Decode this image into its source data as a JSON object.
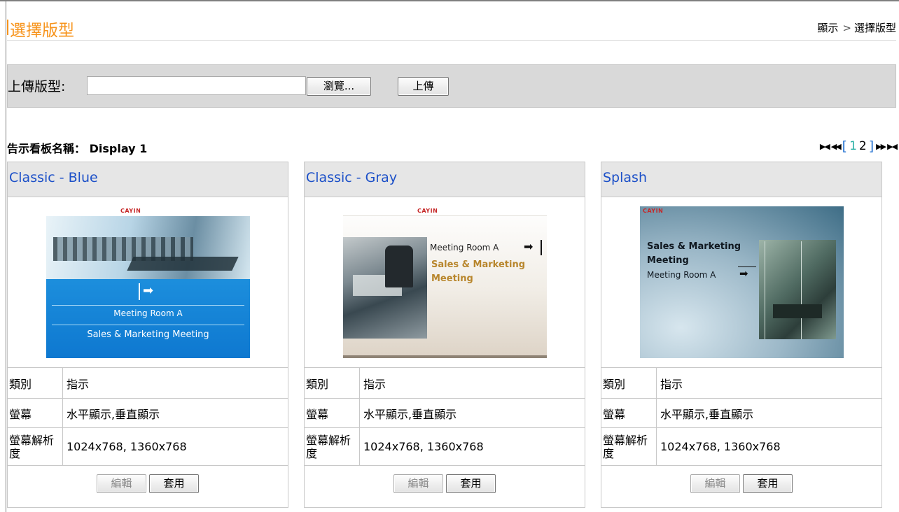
{
  "header": {
    "title": "選擇版型",
    "breadcrumb": {
      "parent": "顯示",
      "separator": ">",
      "current": "選擇版型"
    }
  },
  "upload": {
    "label": "上傳版型:",
    "file_value": "",
    "browse_label": "瀏覽...",
    "upload_label": "上傳"
  },
  "board": {
    "label": "告示看板名稱：",
    "name": "Display 1"
  },
  "pagination": {
    "first_icon": "first-page-icon",
    "prev_icon": "prev-page-icon",
    "open_bracket": "[",
    "pages": [
      "1",
      "2"
    ],
    "current_page": "1",
    "close_bracket": "]",
    "next_icon": "next-page-icon",
    "last_icon": "last-page-icon"
  },
  "labels": {
    "category": "類別",
    "screen": "螢幕",
    "resolution": "螢幕解析度",
    "edit": "編輯",
    "apply": "套用"
  },
  "templates": [
    {
      "name": "Classic - Blue",
      "category": "指示",
      "screen": "水平顯示,垂直顯示",
      "resolution": "1024x768, 1360x768",
      "thumb": {
        "logo": "CAYIN",
        "room": "Meeting Room A",
        "event": "Sales & Marketing Meeting"
      }
    },
    {
      "name": "Classic - Gray",
      "category": "指示",
      "screen": "水平顯示,垂直顯示",
      "resolution": "1024x768, 1360x768",
      "thumb": {
        "logo": "CAYIN",
        "room": "Meeting Room A",
        "event_line1": "Sales & Marketing",
        "event_line2": "Meeting"
      }
    },
    {
      "name": "Splash",
      "category": "指示",
      "screen": "水平顯示,垂直顯示",
      "resolution": "1024x768, 1360x768",
      "thumb": {
        "logo": "CAYIN",
        "event_line1": "Sales & Marketing",
        "event_line2": "Meeting",
        "room": "Meeting Room A"
      }
    }
  ],
  "colors": {
    "title_orange": "#f7941d",
    "link_blue": "#1c50c8",
    "panel_gray": "#d9d9d9",
    "card_header_gray": "#e6e6e6",
    "current_page_teal": "#2ab0a5"
  }
}
